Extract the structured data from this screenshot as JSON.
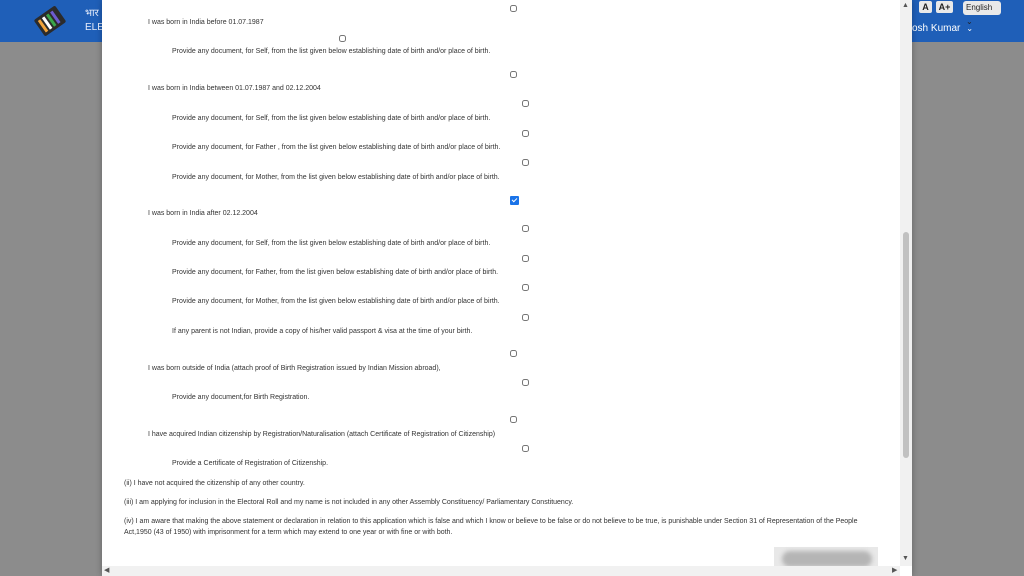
{
  "background": {
    "header_title_line1": "भार",
    "header_title_line2": "ELE",
    "user_name": "osh Kumar",
    "font_small": "A",
    "font_large": "A+",
    "language": "English"
  },
  "declaration": {
    "items": [
      {
        "label": "I was born in India before 01.07.1987",
        "checked": false
      },
      {
        "label": "Provide any document, for Self, from the list given below establishing date of birth and/or place of birth.",
        "checked": false
      },
      {
        "label": "I was born in India between 01.07.1987 and 02.12.2004",
        "checked": false
      },
      {
        "label": "Provide any document, for Self, from the list given below establishing date of birth and/or place of birth.",
        "checked": false
      },
      {
        "label": "Provide any document, for Father , from the list given below establishing date of birth and/or place of birth.",
        "checked": false
      },
      {
        "label": "Provide any document, for Mother, from the list given below establishing date of birth and/or place of birth.",
        "checked": false
      },
      {
        "label": "I was born in India after 02.12.2004",
        "checked": true
      },
      {
        "label": "Provide any document, for Self, from the list given below establishing date of birth and/or place of birth.",
        "checked": false
      },
      {
        "label": "Provide any document, for Father, from the list given below establishing date of birth and/or place of birth.",
        "checked": false
      },
      {
        "label": "Provide any document, for Mother, from the list given below establishing date of birth and/or place of birth.",
        "checked": false
      },
      {
        "label": "If any parent is not Indian, provide a copy of his/her valid passport & visa at the time of your birth.",
        "checked": false
      },
      {
        "label": "I was born outside of India (attach proof of Birth Registration issued by Indian Mission abroad),",
        "checked": false
      },
      {
        "label": "Provide any document,for Birth Registration.",
        "checked": false
      },
      {
        "label": "I have acquired Indian citizenship by Registration/Naturalisation (attach Certificate of Registration of Citizenship)",
        "checked": false
      },
      {
        "label": "Provide a Certificate of Registration of Citizenship.",
        "checked": false
      }
    ],
    "statement_ii": "(ii) I have not acquired the citizenship of any other country.",
    "statement_iii": "(iii) I am applying for inclusion in the Electoral Roll and my name is not included in any other Assembly Constituency/ Parliamentary Constituency.",
    "statement_iv": "(iv) I am aware that making the above statement or declaration in relation to this application which is false and which I know or believe to be false or do not believe to be true, is punishable under Section 31 of Representation of the People Act,1950 (43 of 1950) with imprisonment for a term which may extend to one year or with fine or with both."
  },
  "colors": {
    "header_blue": "#1f5fb8",
    "check_blue": "#1a73e8",
    "overlay_grey": "#8c8c8c"
  },
  "icons": {
    "logo": "evm-logo-icon",
    "scroll_up": "chevron-up-icon",
    "scroll_down": "chevron-down-icon",
    "scroll_left": "chevron-left-icon",
    "scroll_right": "chevron-right-icon"
  }
}
